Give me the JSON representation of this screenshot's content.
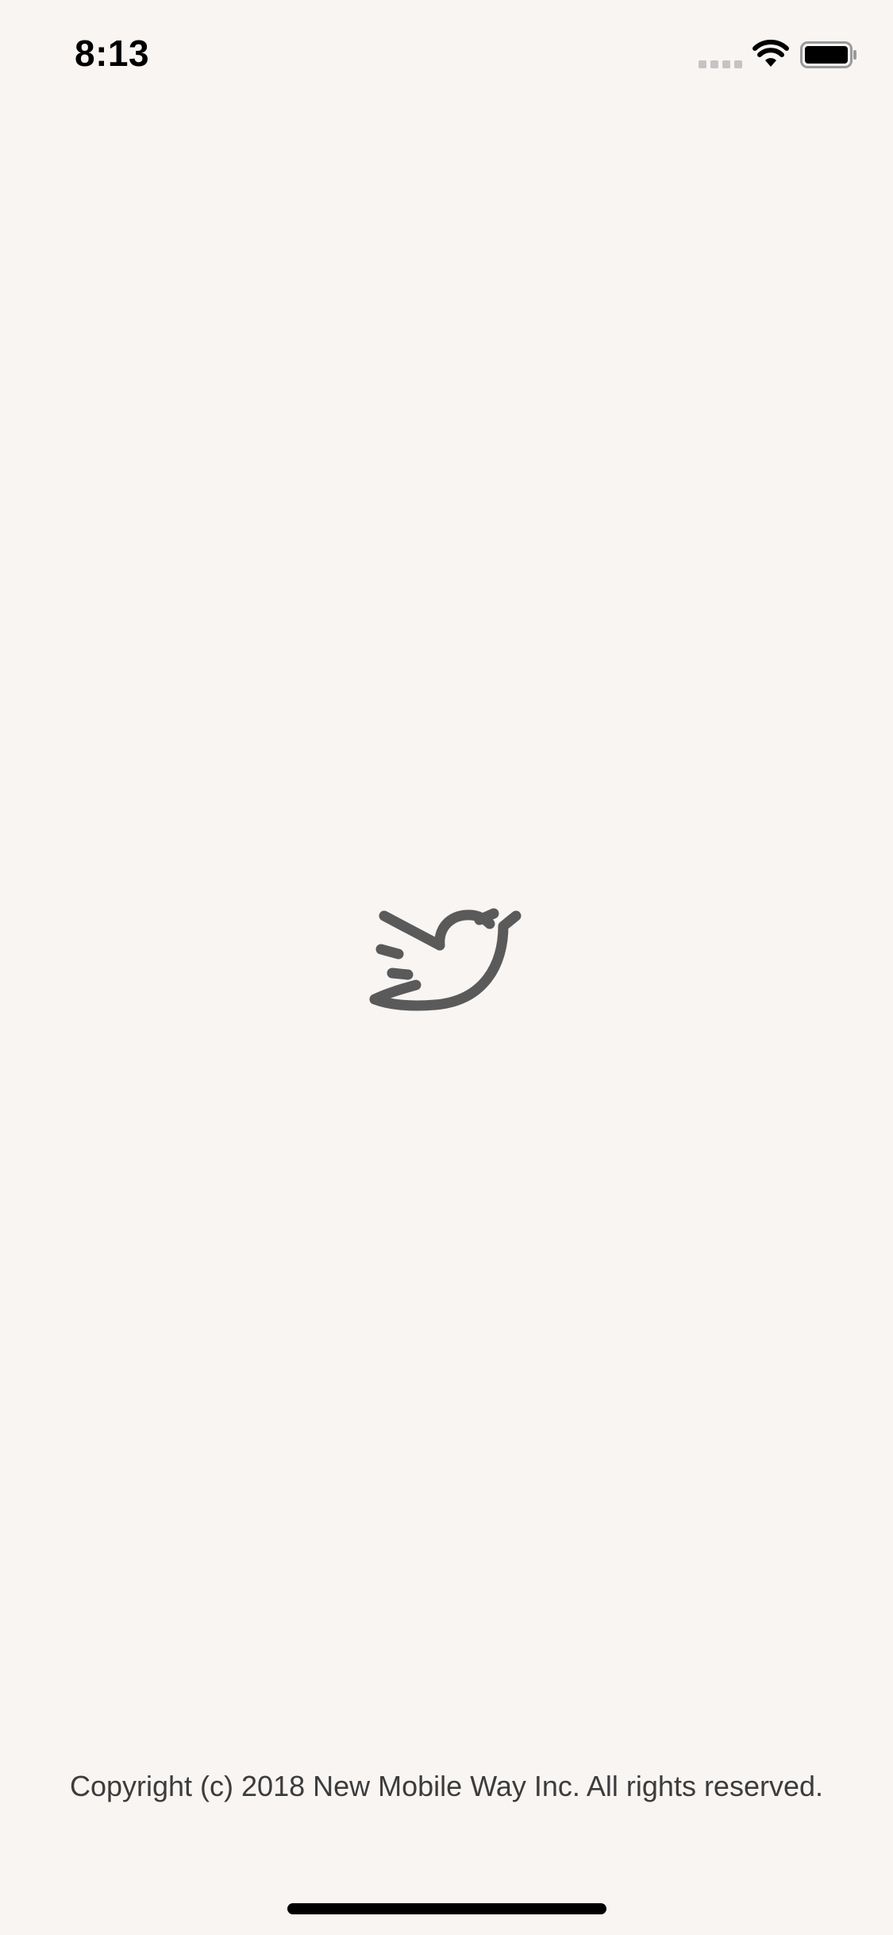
{
  "status_bar": {
    "time": "8:13",
    "signal_icon": "cellular-signal-icon",
    "wifi_icon": "wifi-icon",
    "battery_icon": "battery-icon"
  },
  "splash": {
    "logo_icon": "bird-logo-icon",
    "logo_color": "#5a5a5a",
    "background_color": "#f8f5f3"
  },
  "footer": {
    "copyright": "Copyright (c) 2018 New Mobile Way Inc. All rights reserved."
  }
}
